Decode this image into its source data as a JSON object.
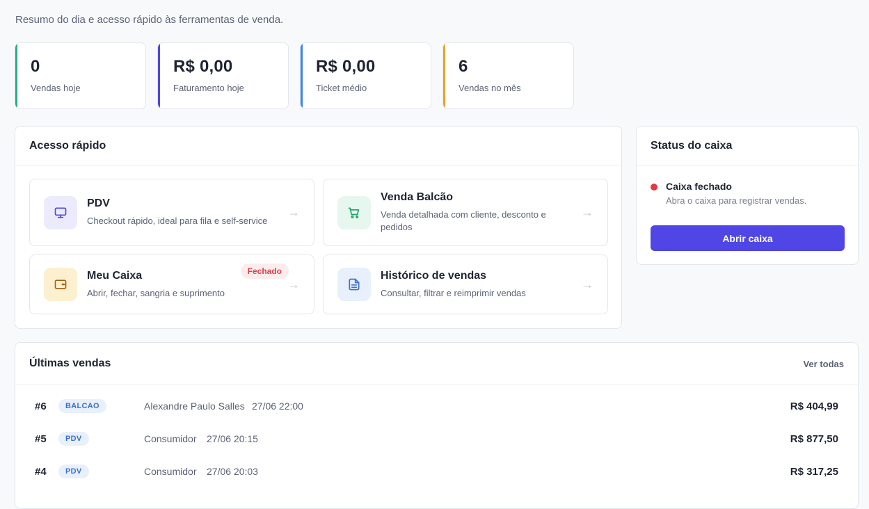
{
  "header": {
    "subtitle": "Resumo do dia e acesso rápido às ferramentas de venda."
  },
  "stats": [
    {
      "value": "0",
      "label": "Vendas hoje",
      "accent": "#22b07d"
    },
    {
      "value": "R$ 0,00",
      "label": "Faturamento hoje",
      "accent": "#4f46e5"
    },
    {
      "value": "R$ 0,00",
      "label": "Ticket médio",
      "accent": "#3b82f6"
    },
    {
      "value": "6",
      "label": "Vendas no mês",
      "accent": "#f0a020"
    }
  ],
  "quick_access": {
    "title": "Acesso rápido",
    "tiles": [
      {
        "title": "PDV",
        "desc": "Checkout rápido, ideal para fila e self-service",
        "icon": "monitor-icon"
      },
      {
        "title": "Venda Balcão",
        "desc": "Venda detalhada com cliente, desconto e pedidos",
        "icon": "cart-icon"
      },
      {
        "title": "Meu Caixa",
        "desc": "Abrir, fechar, sangria e suprimento",
        "icon": "wallet-icon",
        "badge": "Fechado"
      },
      {
        "title": "Histórico de vendas",
        "desc": "Consultar, filtrar e reimprimir vendas",
        "icon": "document-icon"
      }
    ],
    "arrow": "→"
  },
  "cash_status": {
    "title": "Status do caixa",
    "state": "Caixa fechado",
    "hint": "Abra o caixa para registrar vendas.",
    "button": "Abrir caixa"
  },
  "latest_sales": {
    "title": "Últimas vendas",
    "see_all": "Ver todas",
    "rows": [
      {
        "id": "#6",
        "channel": "BALCAO",
        "client": "Alexandre Paulo Salles",
        "time": "27/06 22:00",
        "total": "R$ 404,99"
      },
      {
        "id": "#5",
        "channel": "PDV",
        "client": "Consumidor",
        "time": "27/06 20:15",
        "total": "R$ 877,50"
      },
      {
        "id": "#4",
        "channel": "PDV",
        "client": "Consumidor",
        "time": "27/06 20:03",
        "total": "R$ 317,25"
      }
    ]
  },
  "colors": {
    "primary": "#4f46e5",
    "danger": "#e03b45"
  }
}
